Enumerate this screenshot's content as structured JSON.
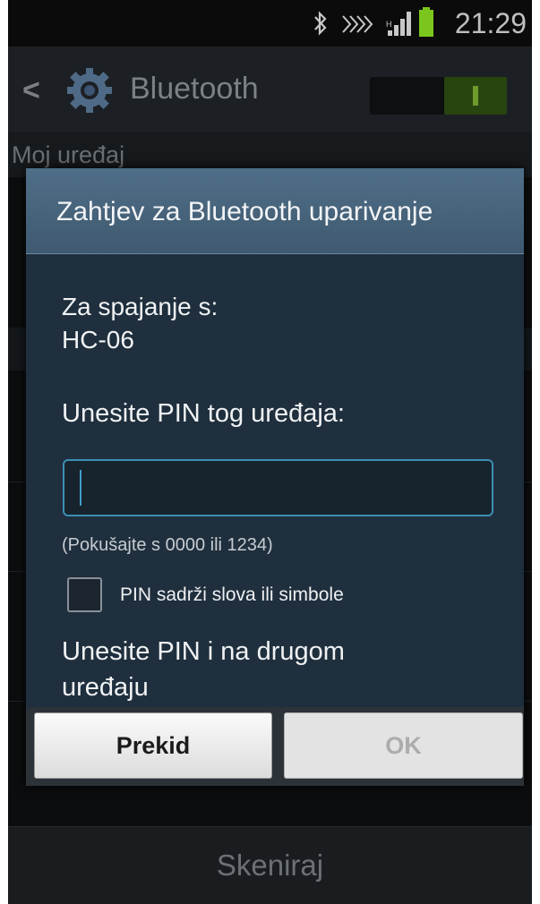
{
  "status_bar": {
    "time": "21:29",
    "icons": [
      "bluetooth-icon",
      "nfc-icon",
      "signal-icon",
      "battery-icon"
    ],
    "battery_color": "#7bc61d"
  },
  "action_bar": {
    "title": "Bluetooth",
    "toggle_on": true
  },
  "background": {
    "section_header": "Moj uređaj",
    "scan_button": "Skeniraj"
  },
  "dialog": {
    "title": "Zahtjev za Bluetooth uparivanje",
    "connect_label": "Za spajanje s:",
    "device_name": "HC-06",
    "enter_pin_label": "Unesite PIN tog uređaja:",
    "pin_input": {
      "value": "",
      "placeholder": ""
    },
    "hint": "(Pokušajte s 0000 ili 1234)",
    "checkbox_label": "PIN sadrži slova ili simbole",
    "checkbox_checked": false,
    "other_device_line1": "Unesite PIN i na drugom",
    "other_device_line2": "uređaju",
    "cancel_label": "Prekid",
    "ok_label": "OK",
    "accent_color": "#3d8fb3"
  }
}
